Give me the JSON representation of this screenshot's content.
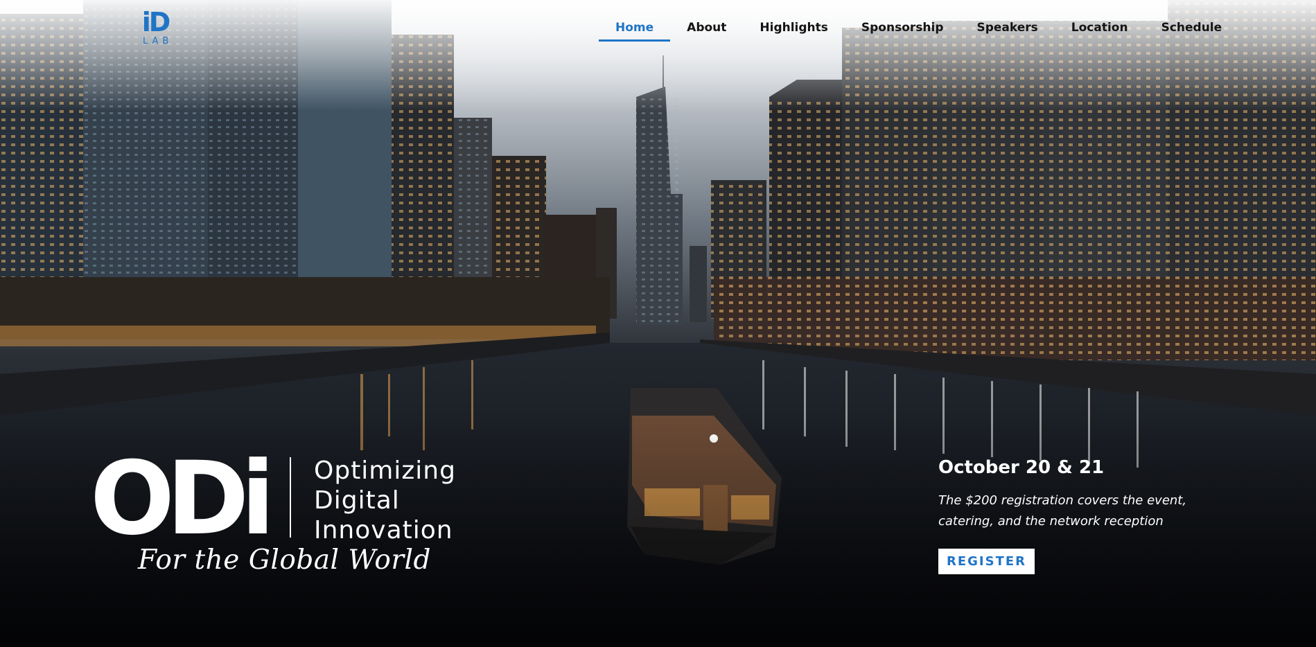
{
  "colors": {
    "accent": "#1f74c6",
    "text_dark": "#141414",
    "text_light": "#ffffff"
  },
  "logo": {
    "mark": "iD",
    "sub": "LAB"
  },
  "nav": {
    "items": [
      {
        "label": "Home",
        "active": true
      },
      {
        "label": "About"
      },
      {
        "label": "Highlights"
      },
      {
        "label": "Sponsorship"
      },
      {
        "label": "Speakers"
      },
      {
        "label": "Location"
      },
      {
        "label": "Schedule"
      }
    ]
  },
  "brand": {
    "wordmark": "ODi",
    "lines": [
      "Optimizing",
      "Digital",
      "Innovation"
    ],
    "tagline": "For the Global World"
  },
  "event": {
    "date": "October 20 & 21",
    "description": "The $200 registration covers the event, catering, and the network reception",
    "register_label": "REGISTER"
  }
}
